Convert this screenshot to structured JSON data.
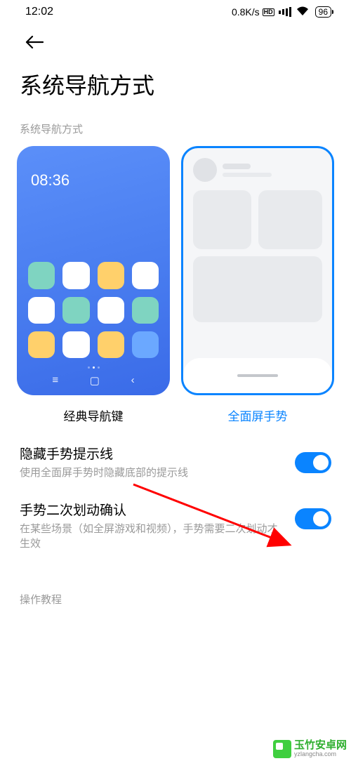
{
  "status": {
    "time": "12:02",
    "net_speed": "0.8K/s",
    "battery": "96"
  },
  "page": {
    "title": "系统导航方式",
    "section_label": "系统导航方式"
  },
  "options": {
    "classic": {
      "label": "经典导航键",
      "preview_time": "08:36"
    },
    "gesture": {
      "label": "全面屏手势"
    }
  },
  "settings": {
    "hide_hint": {
      "title": "隐藏手势提示线",
      "desc": "使用全面屏手势时隐藏底部的提示线",
      "on": true
    },
    "confirm_swipe": {
      "title": "手势二次划动确认",
      "desc": "在某些场景（如全屏游戏和视频），手势需要二次划动才生效",
      "on": true
    }
  },
  "footer": {
    "tutorial": "操作教程"
  },
  "watermark": {
    "name": "玉竹安卓网",
    "url": "yzlangcha.com"
  },
  "colors": {
    "accent": "#0a84ff",
    "red_arrow": "#ff0000"
  }
}
